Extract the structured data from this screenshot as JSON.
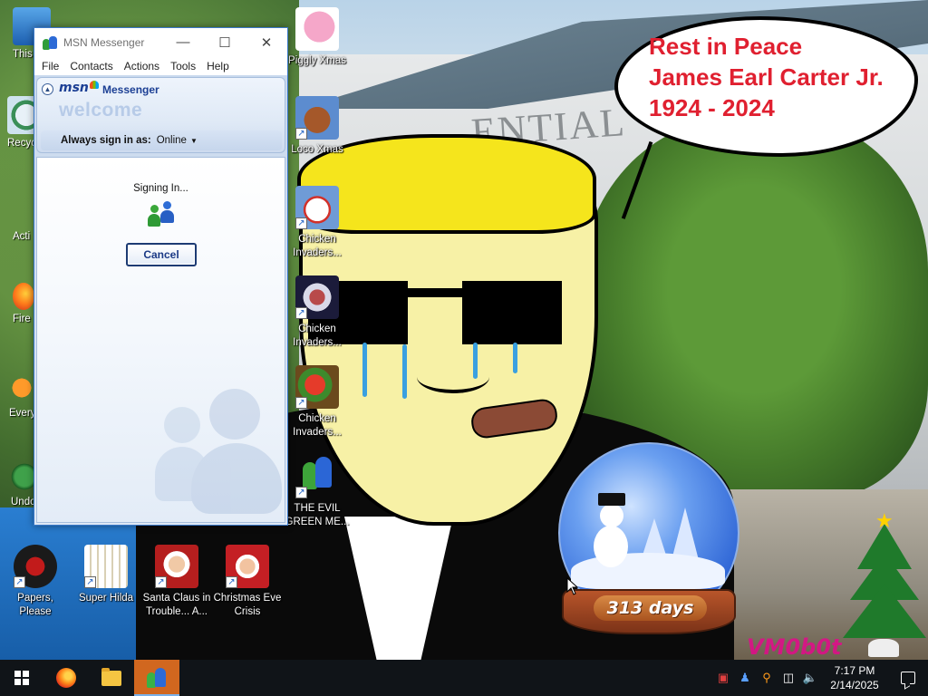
{
  "speech_bubble": {
    "line1": "Rest in Peace",
    "line2": "James Earl Carter Jr.",
    "line3": "1924 - 2024"
  },
  "building_sign": "ENTIAL",
  "snow_globe": {
    "days_label": "313 days"
  },
  "watermark": "VM0b0t",
  "desktop_icons": [
    {
      "label": "This",
      "icon": "this-pc-icon"
    },
    {
      "label": "Recyc",
      "icon": "recycle-bin-icon"
    },
    {
      "label": "Acti",
      "icon": "activate-icon"
    },
    {
      "label": "Fire",
      "icon": "firefox-icon"
    },
    {
      "label": "Every",
      "icon": "everything-icon"
    },
    {
      "label": "Undo",
      "icon": "undo-icon"
    },
    {
      "label": "Piggly Xmas",
      "icon": "piggly-xmas-icon"
    },
    {
      "label": "Loco Xmas",
      "icon": "loco-xmas-icon"
    },
    {
      "label": "Chicken Invaders...",
      "icon": "chicken-invaders-icon"
    },
    {
      "label": "Chicken Invaders...",
      "icon": "chicken-invaders-icon"
    },
    {
      "label": "Chicken Invaders...",
      "icon": "chicken-invaders-icon"
    },
    {
      "label": "THE EVIL GREEN ME...",
      "icon": "evil-green-messenger-icon"
    },
    {
      "label": "Papers, Please",
      "icon": "papers-please-icon"
    },
    {
      "label": "Super Hilda",
      "icon": "super-hilda-icon"
    },
    {
      "label": "Santa Claus in Trouble... A...",
      "icon": "santa-claus-icon"
    },
    {
      "label": "Christmas Eve Crisis",
      "icon": "christmas-eve-crisis-icon"
    }
  ],
  "msn_window": {
    "title": "MSN Messenger",
    "menu": [
      "File",
      "Contacts",
      "Actions",
      "Tools",
      "Help"
    ],
    "logo_text": "msn",
    "product_name": "Messenger",
    "welcome": "welcome",
    "signin_label": "Always sign in as:",
    "status_value": "Online",
    "signing_in_text": "Signing In...",
    "cancel_label": "Cancel"
  },
  "taskbar": {
    "apps": [
      "Firefox",
      "File Explorer",
      "MSN Messenger"
    ],
    "clock_time": "7:17 PM",
    "clock_date": "2/14/2025"
  },
  "colors": {
    "bubble_text": "#e02030",
    "taskbar_bg": "#101418",
    "active_app": "#d1671f",
    "msn_accent": "#1c3f94"
  }
}
